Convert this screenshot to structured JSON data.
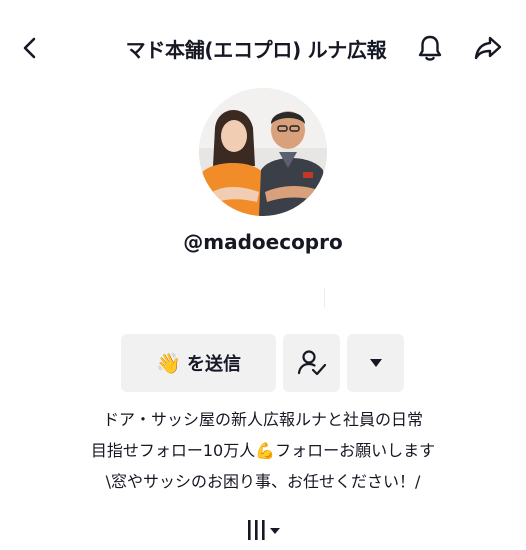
{
  "header": {
    "title": "マド本舗(エコプロ) ルナ広報"
  },
  "profile": {
    "username": "@madoecopro"
  },
  "actions": {
    "message_emoji": "👋",
    "message_label": "を送信"
  },
  "bio": {
    "line1": "ドア・サッシ屋の新人広報ルナと社員の日常",
    "line2_a": "目指せフォロー10万人",
    "line2_emoji": "💪",
    "line2_b": "フォローお願いします",
    "line3": "\\窓やサッシのお困り事、お任せください！/"
  },
  "icons": [
    "back-arrow-icon",
    "bell-icon",
    "share-icon",
    "add-friend-icon",
    "caret-down-icon",
    "links-icon"
  ]
}
